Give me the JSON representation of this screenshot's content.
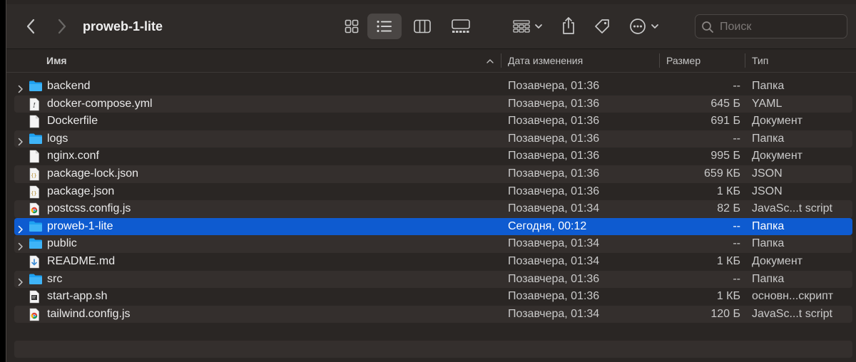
{
  "window": {
    "title": "proweb-1-lite"
  },
  "toolbar": {
    "icons": [
      "chevron-left-icon",
      "chevron-right-icon",
      "grid-view-icon",
      "list-view-icon",
      "column-view-icon",
      "gallery-view-icon",
      "group-icon",
      "share-icon",
      "tag-icon",
      "more-icon",
      "search-icon"
    ],
    "search_placeholder": "Поиск"
  },
  "header": {
    "name": "Имя",
    "date": "Дата изменения",
    "size": "Размер",
    "type": "Тип"
  },
  "colors": {
    "selection": "#0e5bd0",
    "folder": "#1ea1f1",
    "background": "#2a2624",
    "stripe": "#342f2d"
  },
  "files": [
    {
      "name": "backend",
      "date": "Позавчера, 01:36",
      "size": "--",
      "type": "Папка",
      "icon": "folder-icon",
      "expandable": true
    },
    {
      "name": "docker-compose.yml",
      "date": "Позавчера, 01:36",
      "size": "645 Б",
      "type": "YAML",
      "icon": "yaml-file-icon",
      "expandable": false
    },
    {
      "name": "Dockerfile",
      "date": "Позавчера, 01:36",
      "size": "691 Б",
      "type": "Документ",
      "icon": "document-icon",
      "expandable": false
    },
    {
      "name": "logs",
      "date": "Позавчера, 01:36",
      "size": "--",
      "type": "Папка",
      "icon": "folder-icon",
      "expandable": true
    },
    {
      "name": "nginx.conf",
      "date": "Позавчера, 01:36",
      "size": "995 Б",
      "type": "Документ",
      "icon": "document-icon",
      "expandable": false
    },
    {
      "name": "package-lock.json",
      "date": "Позавчера, 01:36",
      "size": "659 КБ",
      "type": "JSON",
      "icon": "json-file-icon",
      "expandable": false
    },
    {
      "name": "package.json",
      "date": "Позавчера, 01:36",
      "size": "1 КБ",
      "type": "JSON",
      "icon": "json-file-icon",
      "expandable": false
    },
    {
      "name": "postcss.config.js",
      "date": "Позавчера, 01:34",
      "size": "82 Б",
      "type": "JavaSc...t script",
      "icon": "js-file-icon",
      "expandable": false
    },
    {
      "name": "proweb-1-lite",
      "date": "Сегодня, 00:12",
      "size": "--",
      "type": "Папка",
      "icon": "folder-icon",
      "expandable": true,
      "selected": true
    },
    {
      "name": "public",
      "date": "Позавчера, 01:34",
      "size": "--",
      "type": "Папка",
      "icon": "folder-icon",
      "expandable": true
    },
    {
      "name": "README.md",
      "date": "Позавчера, 01:34",
      "size": "1 КБ",
      "type": "Документ",
      "icon": "markdown-file-icon",
      "expandable": false
    },
    {
      "name": "src",
      "date": "Позавчера, 01:36",
      "size": "--",
      "type": "Папка",
      "icon": "folder-icon",
      "expandable": true
    },
    {
      "name": "start-app.sh",
      "date": "Позавчера, 01:36",
      "size": "1 КБ",
      "type": "основн...скрипт",
      "icon": "shell-script-icon",
      "expandable": false
    },
    {
      "name": "tailwind.config.js",
      "date": "Позавчера, 01:34",
      "size": "120 Б",
      "type": "JavaSc...t script",
      "icon": "js-file-icon",
      "expandable": false
    }
  ]
}
